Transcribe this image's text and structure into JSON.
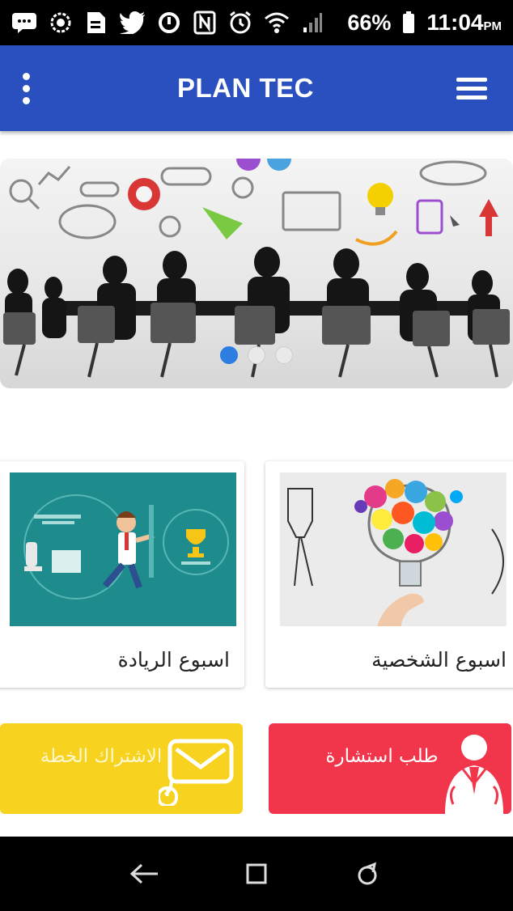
{
  "status_bar": {
    "battery": "66%",
    "time": "11:04",
    "time_suffix": "PM",
    "icons": [
      "message-icon",
      "settings-icon",
      "document-icon",
      "twitter-icon",
      "sync-icon",
      "nfc-icon",
      "alarm-icon",
      "wifi-icon",
      "signal-icon",
      "battery-icon"
    ]
  },
  "app_bar": {
    "title": "PLAN TEC",
    "left_icon": "kebab-menu-icon",
    "right_icon": "hamburger-menu-icon"
  },
  "hero": {
    "slides": 3,
    "active_slide": 1
  },
  "cards": [
    {
      "title": "اسبوع الريادة",
      "image": "comfort-zone-illustration"
    },
    {
      "title": "اسبوع الشخصية",
      "image": "colorful-lightbulb-illustration"
    }
  ],
  "actions": {
    "subscribe": {
      "label": "الاشتراك الخطة",
      "icon": "envelope-mouse-icon",
      "color": "#f7d21f"
    },
    "consult": {
      "label": "طلب استشارة",
      "icon": "businessman-icon",
      "color": "#f1354a"
    }
  },
  "nav_bar": {
    "icons": [
      "back-icon",
      "home-icon",
      "recents-icon"
    ]
  },
  "colors": {
    "app_bar": "#2a50bf",
    "active_dot": "#2d7ee0"
  }
}
